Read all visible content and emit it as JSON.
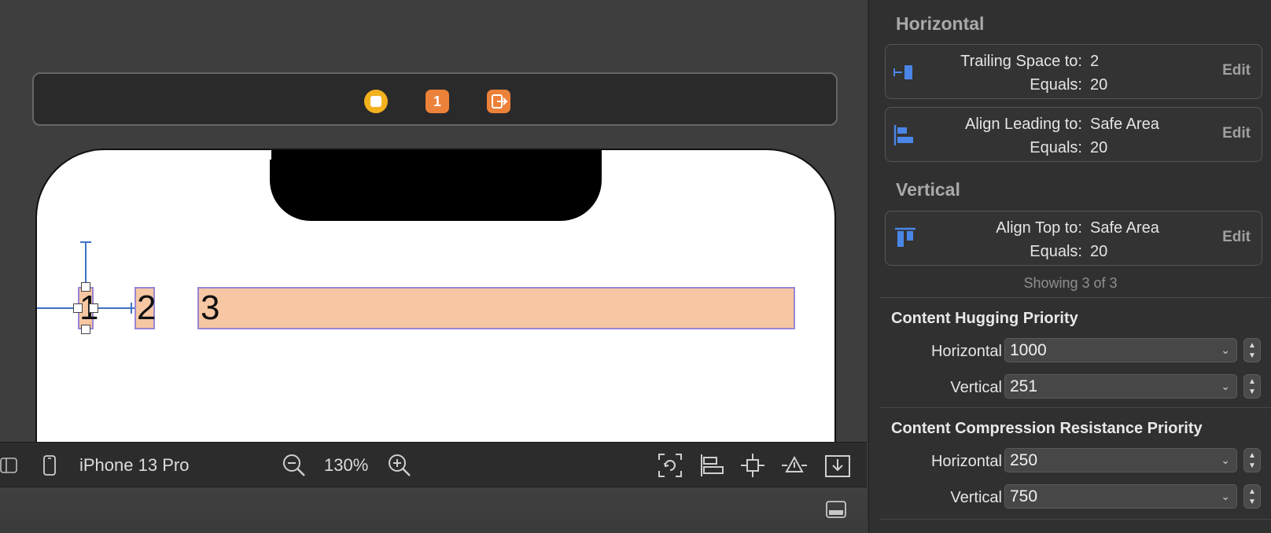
{
  "canvas": {
    "labels": [
      "1",
      "2",
      "3"
    ],
    "dock_first_responder": "1"
  },
  "toolbar": {
    "device_name": "iPhone 13 Pro",
    "zoom": "130%"
  },
  "inspector": {
    "horizontal_title": "Horizontal",
    "vertical_title": "Vertical",
    "constraints": [
      {
        "key1": "Trailing Space to:",
        "val1": "2",
        "key2": "Equals:",
        "val2": "20",
        "edit": "Edit"
      },
      {
        "key1": "Align Leading to:",
        "val1": "Safe Area",
        "key2": "Equals:",
        "val2": "20",
        "edit": "Edit"
      },
      {
        "key1": "Align Top to:",
        "val1": "Safe Area",
        "key2": "Equals:",
        "val2": "20",
        "edit": "Edit"
      }
    ],
    "showing": "Showing 3 of 3",
    "hugging": {
      "title": "Content Hugging Priority",
      "horizontal_label": "Horizontal",
      "horizontal_value": "1000",
      "vertical_label": "Vertical",
      "vertical_value": "251"
    },
    "compression": {
      "title": "Content Compression Resistance Priority",
      "horizontal_label": "Horizontal",
      "horizontal_value": "250",
      "vertical_label": "Vertical",
      "vertical_value": "750"
    }
  }
}
